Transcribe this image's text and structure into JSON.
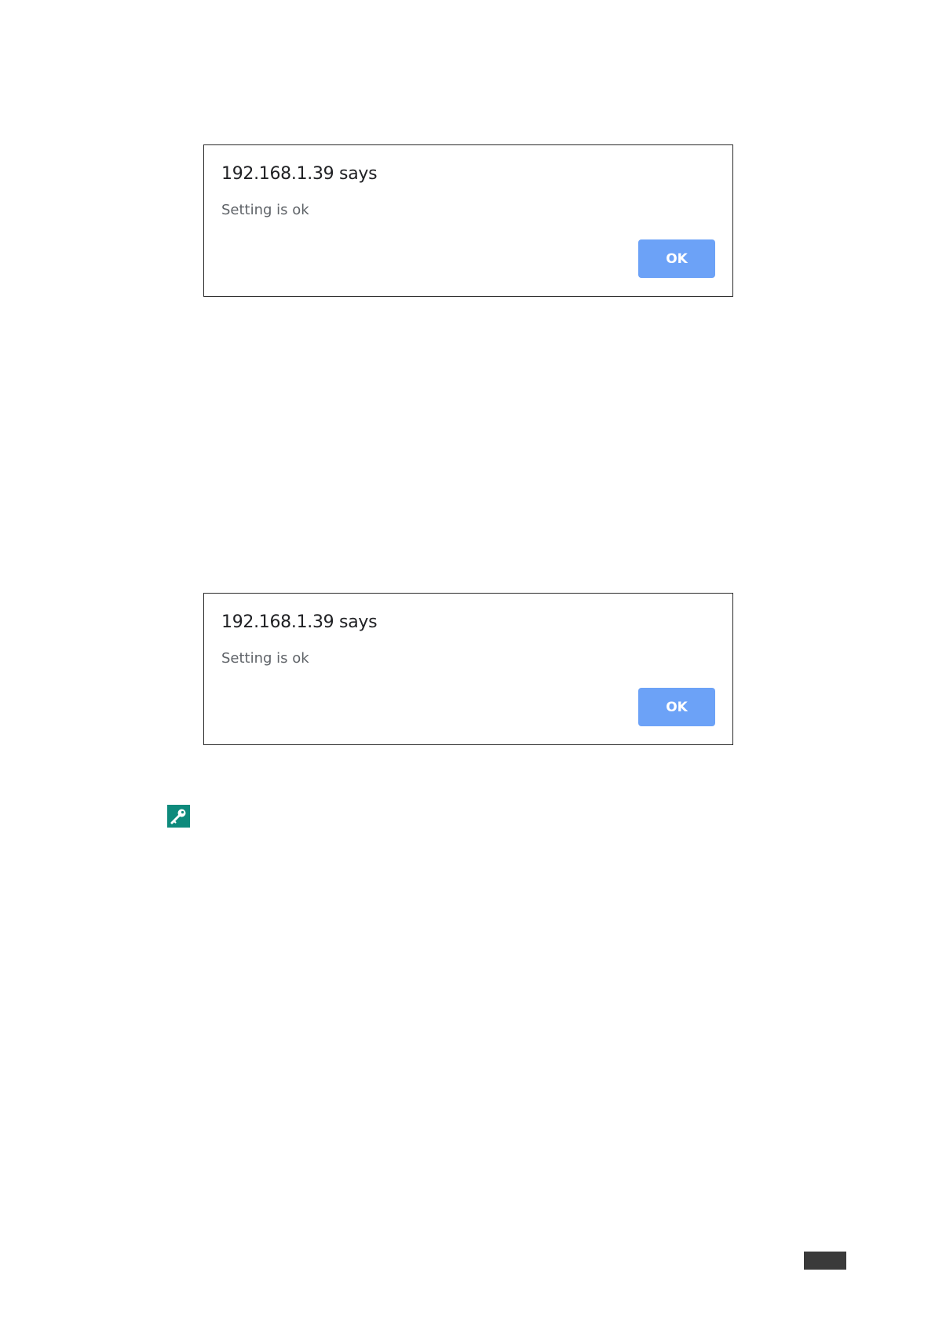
{
  "dialogs": [
    {
      "title": "192.168.1.39 says",
      "message": "Setting is ok",
      "ok_label": "OK"
    },
    {
      "title": "192.168.1.39 says",
      "message": "Setting is ok",
      "ok_label": "OK"
    }
  ],
  "colors": {
    "ok_button": "#6ca2f7",
    "note_icon_bg": "#0e8a7c",
    "page_tab": "#3a3a3a"
  },
  "icons": {
    "note_icon": "key-icon"
  }
}
